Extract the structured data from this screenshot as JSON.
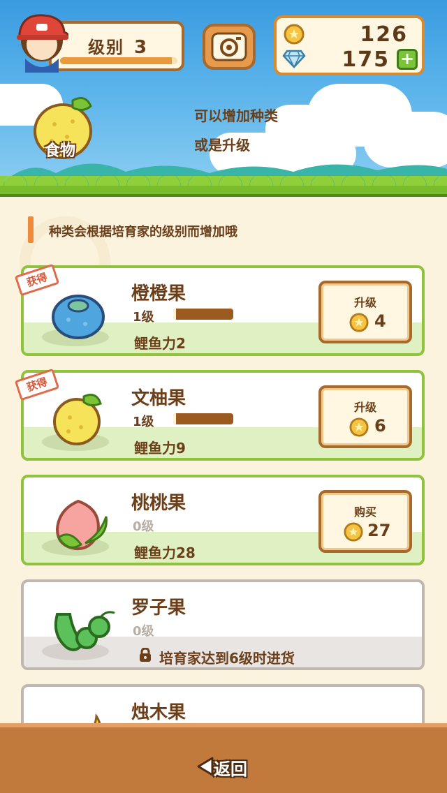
{
  "header": {
    "level_label": "级别",
    "level_value": "3",
    "level_progress": 0.95,
    "coins": "126",
    "gems": "175",
    "plus_label": "+"
  },
  "banner": {
    "category_label": "食物",
    "hint_line1": "可以增加种类",
    "hint_line2": "或是升级"
  },
  "note": "种类会根据培育家的级别而增加哦",
  "items": [
    {
      "name": "橙橙果",
      "level": "1级",
      "xp": 0.05,
      "power": "鲤鱼力2",
      "action": "升级",
      "cost": "4",
      "badge": "获得"
    },
    {
      "name": "文柚果",
      "level": "1级",
      "xp": 0.05,
      "power": "鲤鱼力9",
      "action": "升级",
      "cost": "6",
      "badge": "获得"
    },
    {
      "name": "桃桃果",
      "level": "0级",
      "power": "鲤鱼力28",
      "action": "购买",
      "cost": "27"
    },
    {
      "name": "罗子果",
      "level": "0级",
      "lock_text": "培育家达到6级时进货"
    },
    {
      "name": "烛木果"
    }
  ],
  "footer": {
    "back_label": "返回"
  },
  "colors": {
    "card_border": "#8fc33e",
    "locked_border": "#bfb8b0",
    "accent": "#ee8a3a",
    "footer": "#c17a3c"
  }
}
